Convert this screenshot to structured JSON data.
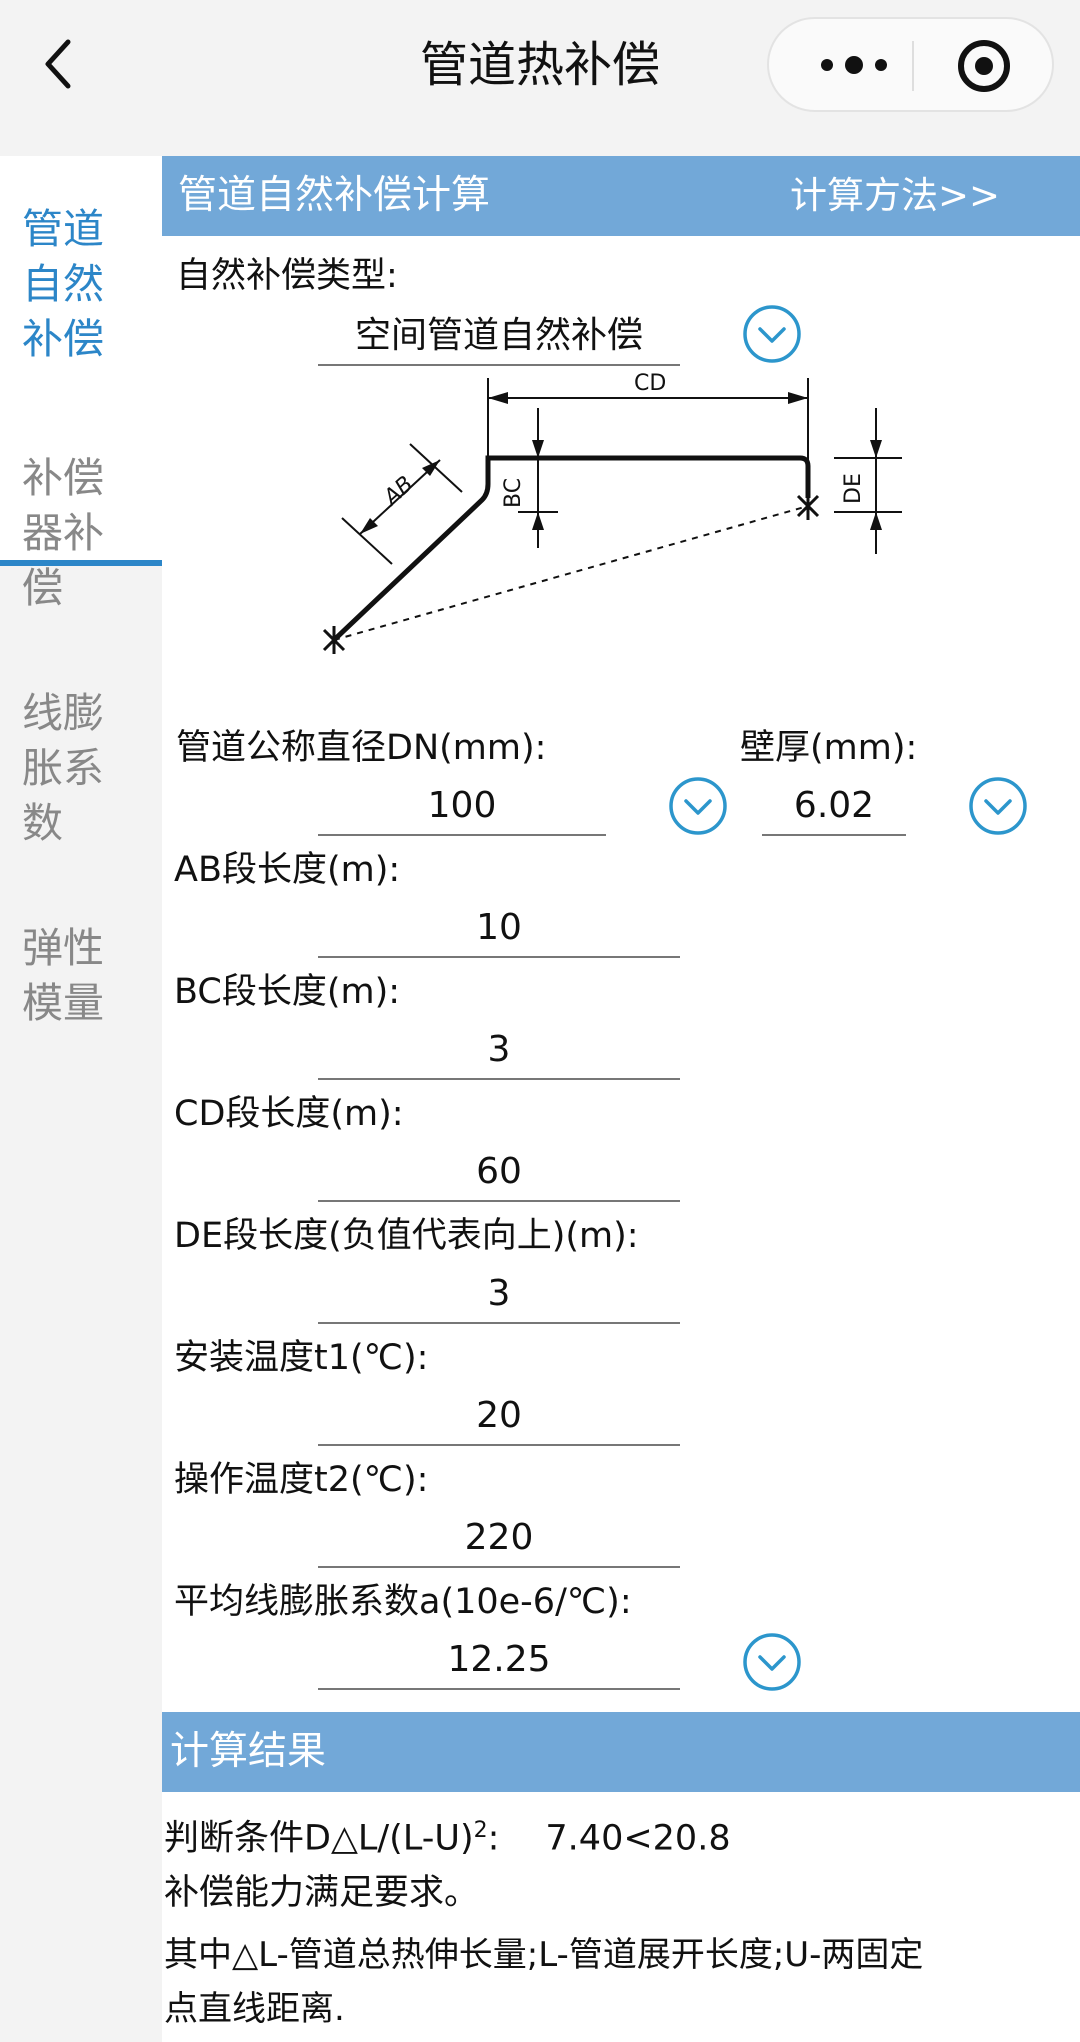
{
  "header": {
    "title": "管道热补偿"
  },
  "sidebar": {
    "items": [
      {
        "label": "管道自然补偿",
        "active": true
      },
      {
        "label": "补偿器补偿",
        "active": false
      },
      {
        "label": "线膨胀系数",
        "active": false
      },
      {
        "label": "弹性模量",
        "active": false
      }
    ]
  },
  "section1": {
    "title": "管道自然补偿计算",
    "link": "计算方法>>"
  },
  "form": {
    "type_label": "自然补偿类型:",
    "type_value": "空间管道自然补偿",
    "dn_label": "管道公称直径DN(mm):",
    "dn_value": "100",
    "wall_label": "壁厚(mm):",
    "wall_value": "6.02",
    "ab_label": "AB段长度(m):",
    "ab_value": "10",
    "bc_label": "BC段长度(m):",
    "bc_value": "3",
    "cd_label": "CD段长度(m):",
    "cd_value": "60",
    "de_label": "DE段长度(负值代表向上)(m):",
    "de_value": "3",
    "t1_label": "安装温度t1(℃):",
    "t1_value": "20",
    "t2_label": "操作温度t2(℃):",
    "t2_value": "220",
    "alpha_label": "平均线膨胀系数a(10e-6/℃):",
    "alpha_value": "12.25"
  },
  "diagram": {
    "labels": {
      "ab": "AB",
      "bc": "BC",
      "cd": "CD",
      "de": "DE"
    }
  },
  "section2": {
    "title": "计算结果"
  },
  "result": {
    "cond_prefix": "判断条件D△L/(L-U)",
    "cond_sup": "2",
    "cond_suffix": ":",
    "cond_value": "7.40<20.8",
    "verdict": "补偿能力满足要求。",
    "note_line1": "其中△L-管道总热伸长量;L-管道展开长度;U-两固定",
    "note_line2": "点直线距离."
  },
  "colors": {
    "accent": "#2c86c8",
    "bar": "#72a8d8",
    "sidebar_bg": "#f3f3f3"
  }
}
